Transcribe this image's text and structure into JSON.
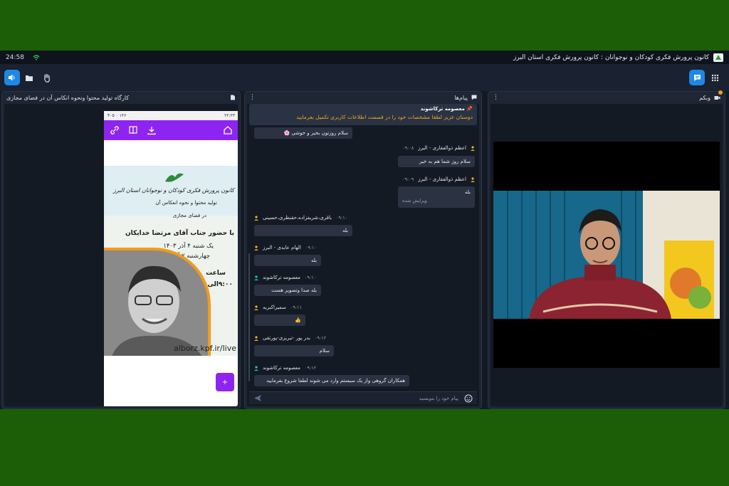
{
  "titlebar": {
    "time": "24:58",
    "title": "کانون پرورش فکری کودکان و نوجوانان : کانون پرورش فکری استان البرز"
  },
  "panels": {
    "content_title": "کارگاه تولید محتوا ونحوه انکاس آن در فضای مجازی",
    "messages_title": "پیام‌ها",
    "webcam_title": "وبکم"
  },
  "phone": {
    "status_left": "۴۰۵ ۰ ۱۴۶",
    "status_right": "۲۲:۲۳",
    "poster": {
      "org_line": "کانون پرورش فکری کودکان و نوجوانان استان البرز",
      "title_line": "تولید محتوا و نحوه انعکاس آن",
      "subtitle_line": "در فضای مجازی",
      "presenter_line": "با حضور جناب آقای مرتضا خدایکان",
      "date1": "یک شنبه ۴ آذر ۱۴۰۳",
      "date2": "چهارشنبه ۷ آذر ۱۴۰۳",
      "time_label": "ساعت",
      "time_value": "۹:۰۰الی ۱۳:۰۰",
      "url": "alborz.kpf.ir/live"
    },
    "fab_label": "+"
  },
  "chat": {
    "pinned_sender": "معصومه ترکاشوند",
    "pinned_message": "دوستان عزیز لطفا مشخصات خود را در قسمت اطلاعات کاربری تکمیل بفرمایید",
    "messages": [
      {
        "text": "سلام روزتون بخیر و خوشی 🌸"
      },
      {
        "sender": "اعظم ذوالفقاری - البرز",
        "time": "۰۹:۰۸",
        "text": "سلام روز شما هم به خیر"
      },
      {
        "sender": "اعظم ذوالفقاری - البرز",
        "time": "۰۹:۰۹",
        "text": "بله",
        "edited": "ویرایش شده"
      },
      {
        "sender": "باقری،شریفزاده،حقنظری،حسینی",
        "time": "۰۹:۱۰",
        "text": "بله"
      },
      {
        "sender": "الهام عابدی - البرز",
        "time": "۰۹:۱۰",
        "text": "بله"
      },
      {
        "sender": "معصومه ترکاشوند",
        "time": "۰۹:۱۰",
        "text": "بله صدا وتصویر هست"
      },
      {
        "sender": "سمیراکبریه",
        "time": "۰۹:۱۱",
        "text": "👍"
      },
      {
        "sender": "بدر پور -تبریزی-پورتقی",
        "time": "۰۹:۱۲",
        "text": "سلام"
      },
      {
        "sender": "معصومه ترکاشوند",
        "time": "۰۹:۱۲",
        "text": "همکاران گروهی واز یک سیستم وارد می شوند لطفا شروع بفرمایید"
      }
    ],
    "compose_placeholder": "پیام خود را بنویسید"
  },
  "colors": {
    "accent": "#1e88e5",
    "phone_purple": "#8e24f2",
    "pinned_text": "#f3a51c",
    "background_green": "#1b5e07"
  }
}
